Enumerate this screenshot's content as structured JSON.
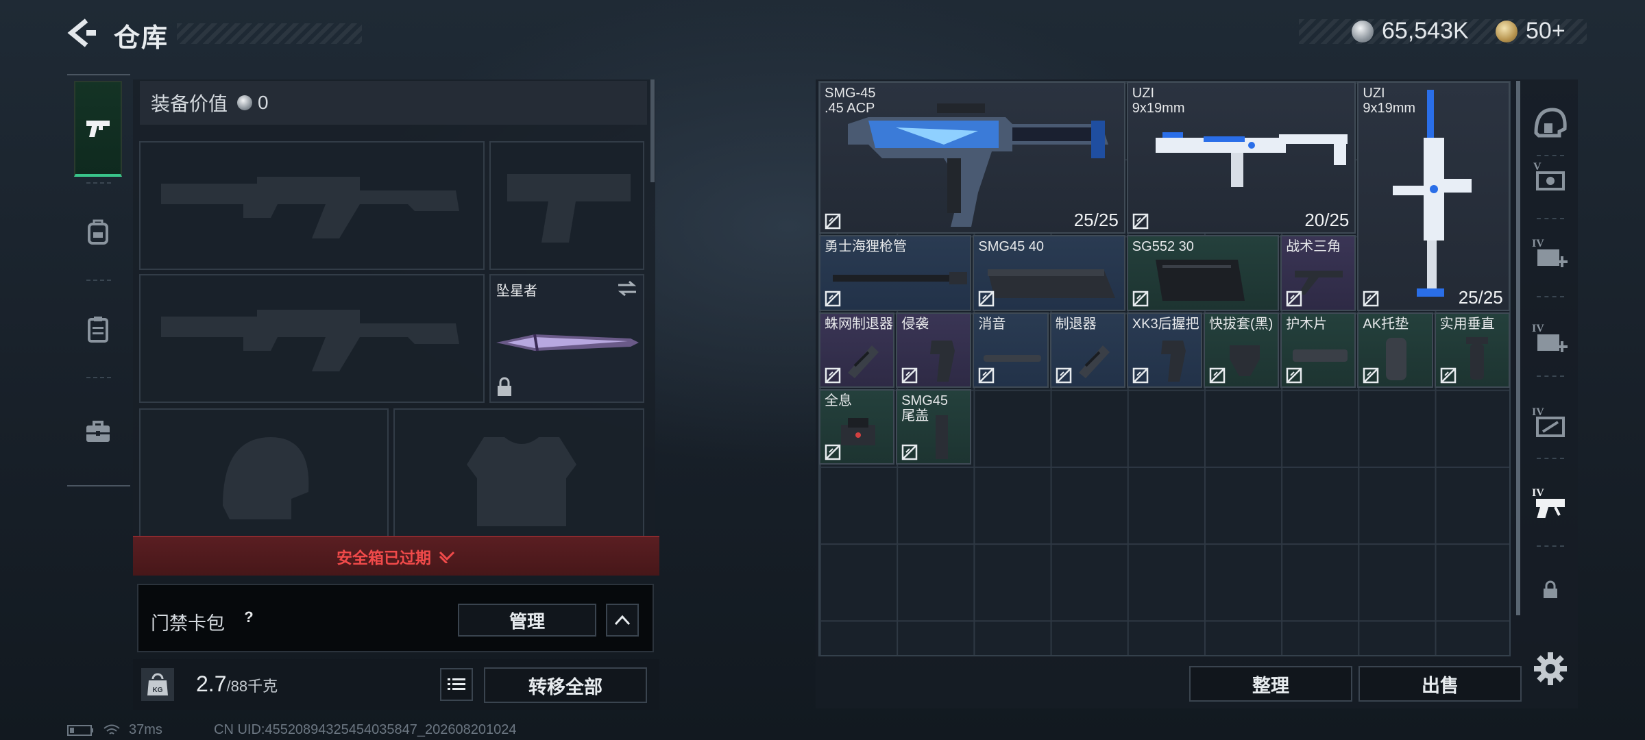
{
  "header": {
    "title": "仓库",
    "currency_silver": "65,543K",
    "currency_gold": "50+"
  },
  "left_tabs": [
    {
      "icon": "pistol-icon",
      "active": true
    },
    {
      "icon": "backpack-icon",
      "active": false
    },
    {
      "icon": "clipboard-icon",
      "active": false
    },
    {
      "icon": "toolbox-icon",
      "active": false
    }
  ],
  "equipment": {
    "value_label": "装备价值",
    "value": "0",
    "special_weapon_label": "坠星者",
    "safebox_status": "安全箱已过期",
    "keycard_label": "门禁卡包",
    "keycard_help": "?",
    "manage_label": "管理",
    "weight_value": "2.7",
    "weight_capacity": "/88千克",
    "weight_icon_text": "KG",
    "transfer_all_label": "转移全部"
  },
  "status": {
    "ping": "37ms",
    "uid": "CN UID:455208943254540358​47_202608201024"
  },
  "storage": {
    "items": [
      {
        "name": "SMG-45\n.45 ACP",
        "count": "25/25",
        "kind": "smg"
      },
      {
        "name": "UZI\n9x19mm",
        "count": "20/25",
        "kind": "uzi"
      },
      {
        "name": "UZI\n9x19mm",
        "count": "25/25",
        "kind": "uzi-v"
      },
      {
        "name": "勇士海狸枪管",
        "count": "",
        "kind": "barrel"
      },
      {
        "name": "SMG45 40",
        "count": "",
        "kind": "mag"
      },
      {
        "name": "SG552 30",
        "count": "",
        "kind": "mag2"
      },
      {
        "name": "战术三角",
        "count": "",
        "kind": "grip"
      },
      {
        "name": "蛛网制退器",
        "count": "",
        "kind": "muzzle"
      },
      {
        "name": "侵袭",
        "count": "",
        "kind": "pgrip"
      },
      {
        "name": "消音",
        "count": "",
        "kind": "supp"
      },
      {
        "name": "制退器",
        "count": "",
        "kind": "muzzle"
      },
      {
        "name": "XK3后握把",
        "count": "",
        "kind": "pgrip"
      },
      {
        "name": "快拔套(黑)",
        "count": "",
        "kind": "sleeve"
      },
      {
        "name": "护木片",
        "count": "",
        "kind": "panel"
      },
      {
        "name": "AK托垫",
        "count": "",
        "kind": "pad"
      },
      {
        "name": "实用垂直",
        "count": "",
        "kind": "vgrip"
      },
      {
        "name": "全息",
        "count": "",
        "kind": "sight"
      },
      {
        "name": "SMG45\n尾盖",
        "count": "",
        "kind": "cap"
      }
    ],
    "sort_label": "整理",
    "sell_label": "出售"
  },
  "right_tabs": [
    {
      "icon": "helmet-icon"
    },
    {
      "icon": "tier5-chest-icon",
      "tier": "V"
    },
    {
      "icon": "tier4-medkit-icon",
      "tier": "IV"
    },
    {
      "icon": "tier4-medkit2-icon",
      "tier": "IV"
    },
    {
      "icon": "tier4-ammo-icon",
      "tier": "IV"
    },
    {
      "icon": "tier4-gun-icon",
      "tier": "IV",
      "active": true
    },
    {
      "icon": "lock-icon"
    }
  ],
  "colors": {
    "accent_green": "#39c48a",
    "warning_red": "#f14a4a"
  }
}
